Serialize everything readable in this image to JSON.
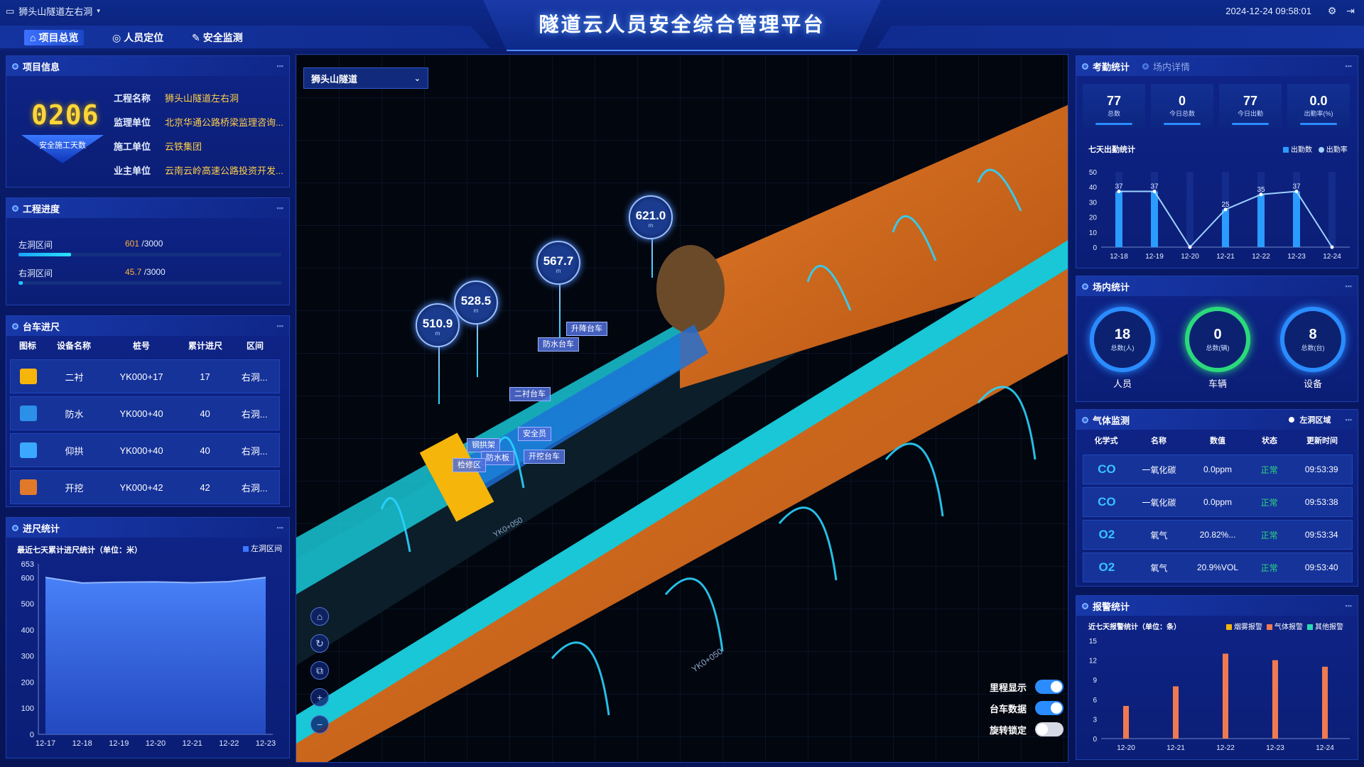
{
  "header": {
    "project_select": "狮头山隧道左右洞",
    "title": "隧道云人员安全综合管理平台",
    "datetime": "2024-12-24 09:58:01",
    "tabs": [
      {
        "label": "项目总览",
        "active": true
      },
      {
        "label": "人员定位",
        "active": false
      },
      {
        "label": "安全监测",
        "active": false
      }
    ]
  },
  "project_info": {
    "title": "项目信息",
    "safe_days": "0206",
    "safe_days_label": "安全施工天数",
    "rows": [
      {
        "key": "工程名称",
        "value": "狮头山隧道左右洞"
      },
      {
        "key": "监理单位",
        "value": "北京华通公路桥梁监理咨询..."
      },
      {
        "key": "施工单位",
        "value": "云铁集团"
      },
      {
        "key": "业主单位",
        "value": "云南云岭高速公路投资开发..."
      }
    ]
  },
  "progress": {
    "title": "工程进度",
    "items": [
      {
        "label": "左洞区间",
        "current": "601",
        "total": "/3000",
        "ratio": 0.2
      },
      {
        "label": "右洞区间",
        "current": "45.7",
        "total": "/3000",
        "ratio": 0.015
      }
    ]
  },
  "trolley": {
    "title": "台车进尺",
    "headers": [
      "图标",
      "设备名称",
      "桩号",
      "累计进尺",
      "区间"
    ],
    "rows": [
      {
        "name": "二衬",
        "pile": "YK000+17",
        "total": "17",
        "zone": "右洞...",
        "icon_color": "#f5b50a"
      },
      {
        "name": "防水",
        "pile": "YK000+40",
        "total": "40",
        "zone": "右洞...",
        "icon_color": "#2c8fe8"
      },
      {
        "name": "仰拱",
        "pile": "YK000+40",
        "total": "40",
        "zone": "右洞...",
        "icon_color": "#3aa8ff"
      },
      {
        "name": "开挖",
        "pile": "YK000+42",
        "total": "42",
        "zone": "右洞...",
        "icon_color": "#e07a2a"
      }
    ]
  },
  "advance_stats": {
    "title": "进尺统计",
    "subtitle": "最近七天累计进尺统计（单位：米）",
    "legend": "左洞区间"
  },
  "map": {
    "tunnel_select": "狮头山隧道",
    "markers": [
      "510.9",
      "528.5",
      "567.7",
      "621.0"
    ],
    "marker_unit": "m",
    "tags": [
      "升降台车",
      "防水台车",
      "二衬台车",
      "安全员",
      "钢拱架",
      "防水板",
      "检修区",
      "开挖台车"
    ],
    "toggles": [
      {
        "label": "里程显示",
        "on": true
      },
      {
        "label": "台车数据",
        "on": true
      },
      {
        "label": "旋转锁定",
        "on": false
      }
    ]
  },
  "attendance": {
    "title": "考勤统计",
    "tab2": "场内详情",
    "cells": [
      {
        "value": "77",
        "label": "总数"
      },
      {
        "value": "0",
        "label": "今日总数"
      },
      {
        "value": "77",
        "label": "今日出勤"
      },
      {
        "value": "0.0",
        "label": "出勤率(%)"
      }
    ],
    "chart_title": "七天出勤统计",
    "legend": [
      "出勤数",
      "出勤率"
    ]
  },
  "site_stats": {
    "title": "场内统计",
    "rings": [
      {
        "value": "18",
        "sub": "总数(人)",
        "label": "人员",
        "color": "#2a8cff"
      },
      {
        "value": "0",
        "sub": "总数(辆)",
        "label": "车辆",
        "color": "#2bd97d"
      },
      {
        "value": "8",
        "sub": "总数(台)",
        "label": "设备",
        "color": "#2a8cff"
      }
    ]
  },
  "gas": {
    "title": "气体监测",
    "zone": "左洞区域",
    "headers": [
      "化学式",
      "名称",
      "数值",
      "状态",
      "更新时间"
    ],
    "rows": [
      {
        "formula": "CO",
        "name": "一氧化碳",
        "value": "0.0ppm",
        "status": "正常",
        "time": "09:53:39"
      },
      {
        "formula": "CO",
        "name": "一氧化碳",
        "value": "0.0ppm",
        "status": "正常",
        "time": "09:53:38"
      },
      {
        "formula": "O2",
        "name": "氧气",
        "value": "20.82%...",
        "status": "正常",
        "time": "09:53:34"
      },
      {
        "formula": "O2",
        "name": "氧气",
        "value": "20.9%VOL",
        "status": "正常",
        "time": "09:53:40"
      }
    ]
  },
  "alarm_stats": {
    "title": "报警统计",
    "subtitle": "近七天报警统计（单位：条）",
    "legend": [
      {
        "name": "烟雾报警",
        "color": "#f5b50a"
      },
      {
        "name": "气体报警",
        "color": "#f07a50"
      },
      {
        "name": "其他报警",
        "color": "#2bd9b0"
      }
    ]
  },
  "chart_data": [
    {
      "type": "area",
      "title": "最近七天累计进尺统计（单位：米）",
      "categories": [
        "12-17",
        "12-18",
        "12-19",
        "12-20",
        "12-21",
        "12-22",
        "12-23"
      ],
      "series": [
        {
          "name": "左洞区间",
          "values": [
            601,
            580,
            583,
            584,
            581,
            585,
            601
          ]
        }
      ],
      "yticks": [
        "0",
        "100",
        "200",
        "300",
        "400",
        "500",
        "600",
        "653"
      ],
      "ylim": [
        0,
        653
      ]
    },
    {
      "type": "bar",
      "title": "七天出勤统计",
      "categories": [
        "12-18",
        "12-19",
        "12-20",
        "12-21",
        "12-22",
        "12-23",
        "12-24"
      ],
      "series": [
        {
          "name": "出勤数",
          "values": [
            37,
            37,
            0,
            25,
            35,
            37,
            0
          ]
        },
        {
          "name": "出勤率",
          "values": [
            37,
            37,
            0,
            25,
            35,
            37,
            0
          ]
        }
      ],
      "yticks": [
        "0",
        "10",
        "20",
        "30",
        "40",
        "50"
      ],
      "ylim": [
        0,
        50
      ]
    },
    {
      "type": "bar",
      "title": "近七天报警统计（单位：条）",
      "categories": [
        "12-20",
        "12-21",
        "12-22",
        "12-23",
        "12-24"
      ],
      "series": [
        {
          "name": "气体报警",
          "values": [
            5,
            8,
            13,
            12,
            11
          ]
        }
      ],
      "yticks": [
        "0",
        "3",
        "6",
        "9",
        "12",
        "15"
      ],
      "ylim": [
        0,
        15
      ]
    }
  ]
}
